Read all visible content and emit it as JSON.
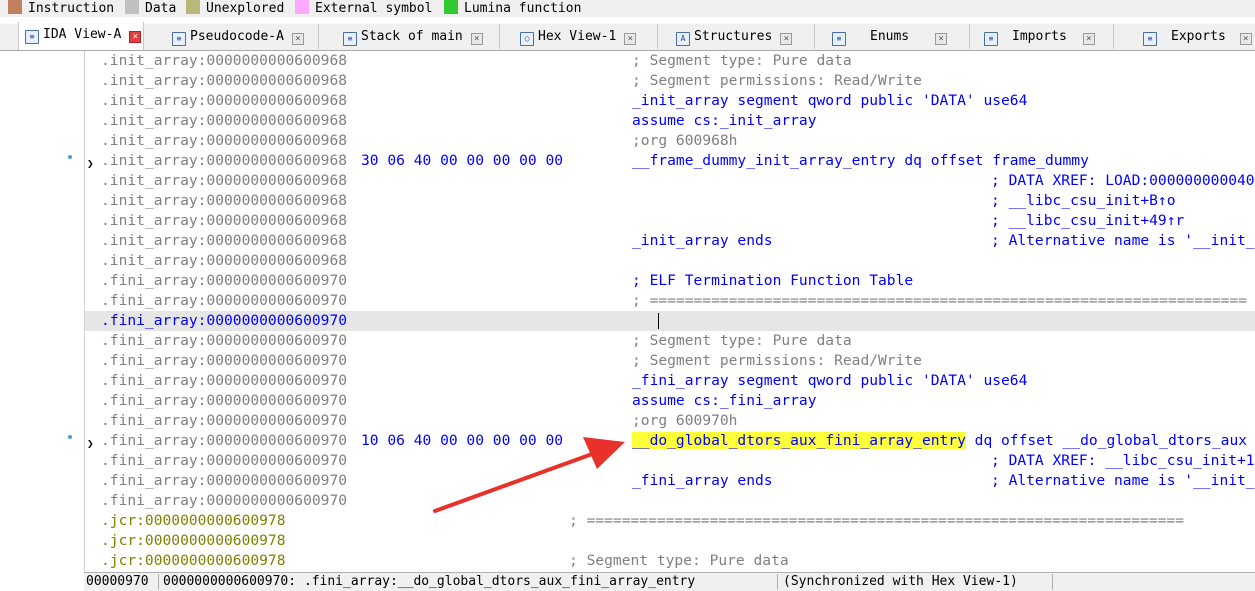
{
  "legend": [
    {
      "label": "Instruction",
      "color": "#c08060"
    },
    {
      "label": "Data",
      "color": "#c0c0c0"
    },
    {
      "label": "Unexplored",
      "color": "#b8b878"
    },
    {
      "label": "External symbol",
      "color": "#ffa8ff"
    },
    {
      "label": "Lumina function",
      "color": "#32c832"
    }
  ],
  "tabs": [
    {
      "label": "IDA View-A",
      "icon": "disassembly-icon",
      "active": true
    },
    {
      "label": "Pseudocode-A",
      "icon": "pseudocode-icon"
    },
    {
      "label": "Stack of main",
      "icon": "stack-icon"
    },
    {
      "label": "Hex View-1",
      "icon": "hex-icon"
    },
    {
      "label": "Structures",
      "icon": "structures-icon"
    },
    {
      "label": "Enums",
      "icon": "enums-icon"
    },
    {
      "label": "Imports",
      "icon": "imports-icon"
    },
    {
      "label": "Exports",
      "icon": "exports-icon"
    }
  ],
  "lines": [
    {
      "addr": ".init_array:0000000000600968",
      "code": "; Segment type: Pure data"
    },
    {
      "addr": ".init_array:0000000000600968",
      "code": "; Segment permissions: Read/Write"
    },
    {
      "addr": ".init_array:0000000000600968",
      "code": "_init_array segment qword public 'DATA' use64"
    },
    {
      "addr": ".init_array:0000000000600968",
      "code": "assume cs:_init_array"
    },
    {
      "addr": ".init_array:0000000000600968",
      "code": ";org 600968h"
    },
    {
      "addr": ".init_array:0000000000600968",
      "bytes": "30 06 40 00 00 00 00 00",
      "code": "__frame_dummy_init_array_entry dq offset frame_dummy"
    },
    {
      "addr": ".init_array:0000000000600968",
      "code2": "; DATA XREF: LOAD:000000000040"
    },
    {
      "addr": ".init_array:0000000000600968",
      "code2": "; __libc_csu_init+B↑o"
    },
    {
      "addr": ".init_array:0000000000600968",
      "code2": "; __libc_csu_init+49↑r"
    },
    {
      "addr": ".init_array:0000000000600968",
      "code": "_init_array ends",
      "code2": "; Alternative name is '__init_"
    },
    {
      "addr": ".init_array:0000000000600968"
    },
    {
      "addr": ".fini_array:0000000000600970",
      "code": "; ELF Termination Function Table"
    },
    {
      "addr": ".fini_array:0000000000600970",
      "code": "; ===================================================================="
    },
    {
      "addr": ".fini_array:0000000000600970"
    },
    {
      "addr": ".fini_array:0000000000600970",
      "code": "; Segment type: Pure data"
    },
    {
      "addr": ".fini_array:0000000000600970",
      "code": "; Segment permissions: Read/Write"
    },
    {
      "addr": ".fini_array:0000000000600970",
      "code": "_fini_array segment qword public 'DATA' use64"
    },
    {
      "addr": ".fini_array:0000000000600970",
      "code": "assume cs:_fini_array"
    },
    {
      "addr": ".fini_array:0000000000600970",
      "code": ";org 600970h"
    },
    {
      "addr": ".fini_array:0000000000600970",
      "bytes": "10 06 40 00 00 00 00 00",
      "code_hl": "__do_global_dtors_aux_fini_array_entry",
      "code_rest": " dq offset __do_global_dtors_aux"
    },
    {
      "addr": ".fini_array:0000000000600970",
      "code2": "; DATA XREF: __libc_csu_init+1"
    },
    {
      "addr": ".fini_array:0000000000600970",
      "code": "_fini_array ends",
      "code2": "; Alternative name is '__init_"
    },
    {
      "addr": ".fini_array:0000000000600970"
    },
    {
      "addr": ".jcr:0000000000600978",
      "code": "; ===================================================================="
    },
    {
      "addr": ".jcr:0000000000600978"
    },
    {
      "addr": ".jcr:0000000000600978",
      "code": "; Segment type: Pure data"
    }
  ],
  "status": {
    "offset": "00000970",
    "location": "0000000000600970: .fini_array:__do_global_dtors_aux_fini_array_entry",
    "sync": "(Synchronized with Hex View-1)"
  },
  "colors": {
    "highlight": "#ffff3a",
    "annotation_arrow": "#e8312a",
    "address_blue": "#0000ff",
    "jcr_olive": "#808000"
  }
}
